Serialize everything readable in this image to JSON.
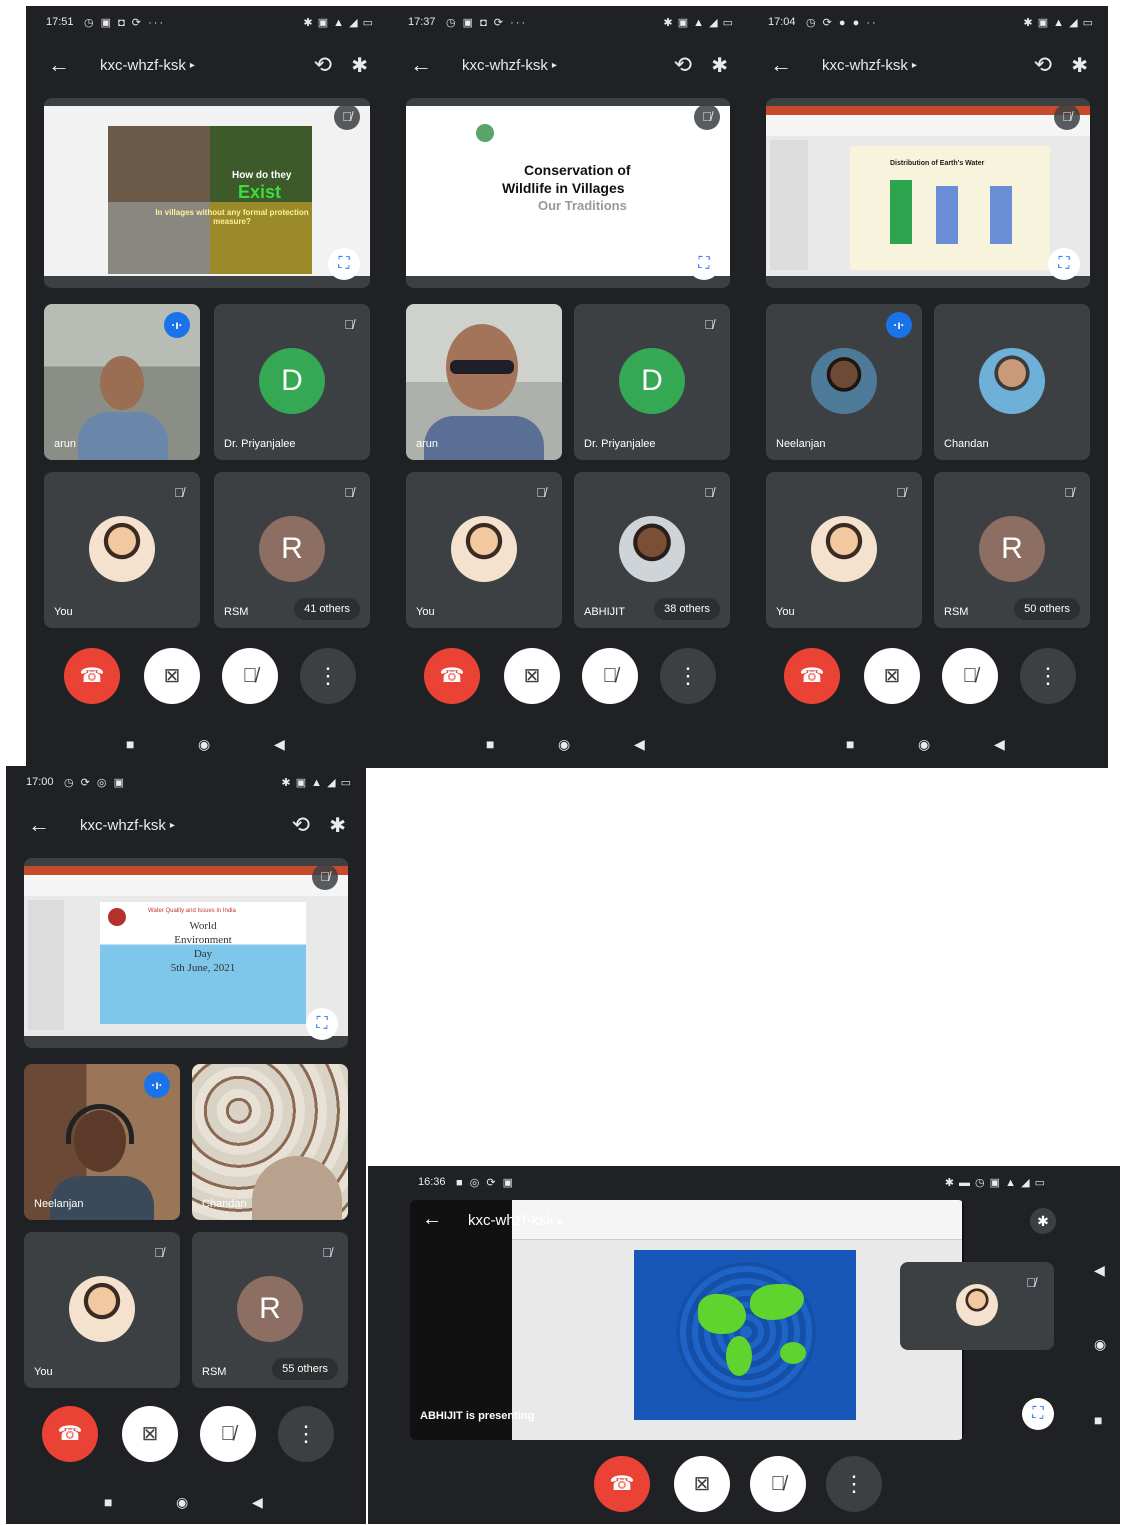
{
  "meeting_code": "kxc-whzf-ksk",
  "caret": "▸",
  "icons": {
    "back": "arrow-left-icon",
    "flip": "camera-flip-icon",
    "bluetooth": "bluetooth-icon",
    "mic_off": "mic-off-icon",
    "camera_off": "camera-off-icon",
    "end_call": "end-call-icon",
    "more": "more-vert-icon",
    "fullscreen": "fullscreen-icon",
    "speaking": "speaking-indicator-icon"
  },
  "nav": {
    "recent": "■",
    "home": "◉",
    "back": "◀"
  },
  "colors": {
    "end_call": "#ea4335",
    "speaking": "#1a73e8",
    "tile_bg": "#3c4043",
    "app_bg": "#202124",
    "avatar_d": "#34a853",
    "avatar_r": "#8d6e63"
  },
  "screens": [
    {
      "time": "17:51",
      "present_slide": {
        "line1": "How do they",
        "line2": "Exist",
        "line3": "In villages without any formal protection measure?"
      },
      "tiles": [
        {
          "name": "arun",
          "speaking": true
        },
        {
          "name": "Dr. Priyanjalee",
          "initial": "D"
        },
        {
          "name": "You"
        },
        {
          "name": "RSM",
          "initial": "R",
          "others": "41 others"
        }
      ]
    },
    {
      "time": "17:37",
      "present_slide": {
        "line1": "Conservation of",
        "line2": "Wildlife in Villages",
        "line3": "Our Traditions"
      },
      "tiles": [
        {
          "name": "arun"
        },
        {
          "name": "Dr. Priyanjalee",
          "initial": "D"
        },
        {
          "name": "You"
        },
        {
          "name": "ABHIJIT",
          "others": "38 others"
        }
      ]
    },
    {
      "time": "17:04",
      "present_slide": {
        "line1": "Distribution of Earth's Water"
      },
      "tiles": [
        {
          "name": "Neelanjan",
          "speaking": true
        },
        {
          "name": "Chandan"
        },
        {
          "name": "You"
        },
        {
          "name": "RSM",
          "initial": "R",
          "others": "50 others"
        }
      ]
    },
    {
      "time": "17:00",
      "present_slide": {
        "line1": "Water Quality and Issues in India",
        "line2": "World",
        "line3": "Environment",
        "line4": "Day",
        "line5": "5th June, 2021"
      },
      "tiles": [
        {
          "name": "Neelanjan",
          "speaking": true
        },
        {
          "name": "Chandan"
        },
        {
          "name": "You"
        },
        {
          "name": "RSM",
          "initial": "R",
          "others": "55 others"
        }
      ]
    },
    {
      "time": "16:36",
      "presenter_label": "ABHIJIT is presenting"
    }
  ]
}
